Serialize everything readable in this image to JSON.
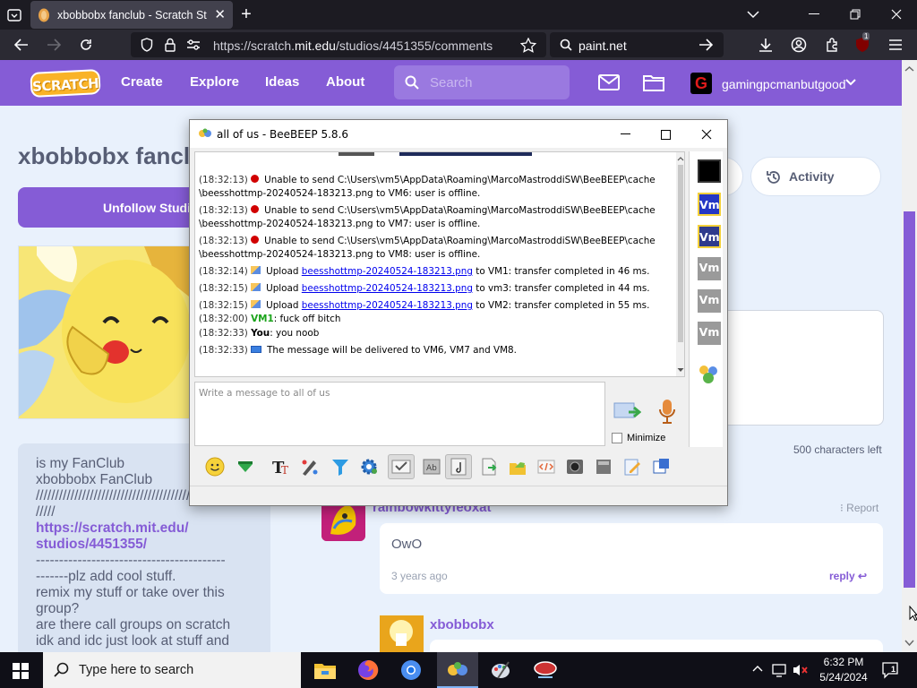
{
  "browser": {
    "tab_title": "xbobbobx fanclub - Scratch Stu",
    "url_host": "https://scratch.",
    "url_domain": "mit.edu",
    "url_path": "/studios/4451355/comments",
    "search_query": "paint.net",
    "extension_badge": "1"
  },
  "scratch_nav": {
    "logo": "SCRATCH",
    "create": "Create",
    "explore": "Explore",
    "ideas": "Ideas",
    "about": "About",
    "search_placeholder": "Search",
    "username": "gamingpcmanbutgood",
    "user_initial": "G"
  },
  "studio": {
    "title": "xbobbobx fanclub",
    "unfollow_label": "Unfollow Studio",
    "activity_label": "Activity",
    "description_lines": [
      "is my FanClub",
      "xbobbobx FanClub",
      "////////////////////////////////////////",
      "/////",
      "https://scratch.mit.edu/",
      "studios/4451355/",
      "-----------------------------------------",
      "-------plz add cool stuff.",
      "remix my stuff or take over this",
      "group?",
      "are there call groups on scratch",
      "idk and idc just look at stuff and"
    ],
    "chars_left": "500 characters left"
  },
  "comments": [
    {
      "author": "rainbowkittyfeoxat",
      "report": "Report",
      "text": "OwO",
      "time": "3 years ago",
      "reply": "reply"
    },
    {
      "author": "xbobbobx"
    }
  ],
  "beebeep": {
    "window_title": "all of us - BeeBEEP 5.8.6",
    "lines": [
      {
        "time": "(18:32:13)",
        "text": " Unable to send C:\\Users\\vm5\\AppData\\Roaming\\MarcoMastroddiSW\\BeeBEEP\\cache",
        "cont": "\\beesshottmp-20240524-183213.png to VM6: user is offline."
      },
      {
        "time": "(18:32:13)",
        "text": " Unable to send C:\\Users\\vm5\\AppData\\Roaming\\MarcoMastroddiSW\\BeeBEEP\\cache",
        "cont": "\\beesshottmp-20240524-183213.png to VM7: user is offline."
      },
      {
        "time": "(18:32:13)",
        "text": " Unable to send C:\\Users\\vm5\\AppData\\Roaming\\MarcoMastroddiSW\\BeeBEEP\\cache",
        "cont": "\\beesshottmp-20240524-183213.png to VM8: user is offline."
      }
    ],
    "uploads": [
      {
        "time": "(18:32:14)",
        "pre": " Upload ",
        "file": "beesshottmp-20240524-183213.png",
        "post": " to VM1: transfer completed in 46 ms."
      },
      {
        "time": "(18:32:15)",
        "pre": " Upload ",
        "file": "beesshottmp-20240524-183213.png",
        "post": " to vm3: transfer completed in 44 ms."
      },
      {
        "time": "(18:32:15)",
        "pre": " Upload ",
        "file": "beesshottmp-20240524-183213.png",
        "post": " to VM2: transfer completed in 55 ms."
      }
    ],
    "msg1": {
      "time": "(18:32:00)",
      "user": "VM1",
      "text": ": fuck off bitch"
    },
    "msg2": {
      "time": "(18:32:33)",
      "user": "You",
      "text": ": you noob"
    },
    "msg3": {
      "time": "(18:32:33)",
      "text": " The message will be delivered to VM6, VM7 and VM8."
    },
    "input_placeholder": "Write a message to all of us",
    "minimize_label": "Minimize",
    "user_badges": [
      "Vm",
      "Vm",
      "Vm",
      "Vm",
      "Vm"
    ]
  },
  "taskbar": {
    "search_placeholder": "Type here to search",
    "time": "6:32 PM",
    "date": "5/24/2024"
  }
}
